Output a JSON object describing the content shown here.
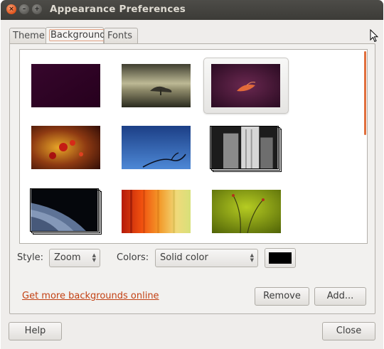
{
  "window": {
    "title": "Appearance Preferences",
    "controls": {
      "close": "×",
      "minimize": "–",
      "maximize": "+"
    }
  },
  "tabs": [
    {
      "label": "Theme",
      "active": false
    },
    {
      "label": "Background",
      "active": true
    },
    {
      "label": "Fonts",
      "active": false
    }
  ],
  "gallery": {
    "wallpapers": [
      {
        "name": "dark-purple",
        "colors": [
          "#2c0020",
          "#3a002a"
        ],
        "selected": false
      },
      {
        "name": "sepia-tree",
        "colors": [
          "#b8b48f",
          "#2e2d22"
        ],
        "selected": false
      },
      {
        "name": "ubuntu-purple-leaf",
        "colors": [
          "#5d1f44",
          "#2e0f24"
        ],
        "selected": true
      },
      {
        "name": "red-berries",
        "colors": [
          "#f0b030",
          "#6e0d0a"
        ],
        "selected": false
      },
      {
        "name": "blue-sky-branch",
        "colors": [
          "#3f78c9",
          "#0f2a63"
        ],
        "selected": false
      },
      {
        "name": "bw-skyscrapers",
        "colors": [
          "#e9e9e9",
          "#1a1a1a"
        ],
        "selected": false
      },
      {
        "name": "earth-from-space",
        "colors": [
          "#6a7fa3",
          "#0a0d14"
        ],
        "selected": false
      },
      {
        "name": "colorful-curtains",
        "colors": [
          "#f05a16",
          "#f2d66a"
        ],
        "selected": false
      },
      {
        "name": "green-plant-stems",
        "colors": [
          "#a3b81b",
          "#556a08"
        ],
        "selected": false
      }
    ]
  },
  "style": {
    "label": "Style:",
    "value": "Zoom"
  },
  "colors": {
    "label": "Colors:",
    "value": "Solid color",
    "swatch": "#000000"
  },
  "link": {
    "label": "Get more backgrounds online"
  },
  "buttons": {
    "remove": "Remove",
    "add": "Add...",
    "help": "Help",
    "close": "Close"
  },
  "theme": {
    "accent": "#e16f3d",
    "link_color": "#c34113",
    "titlebar": "#3c3b37"
  }
}
